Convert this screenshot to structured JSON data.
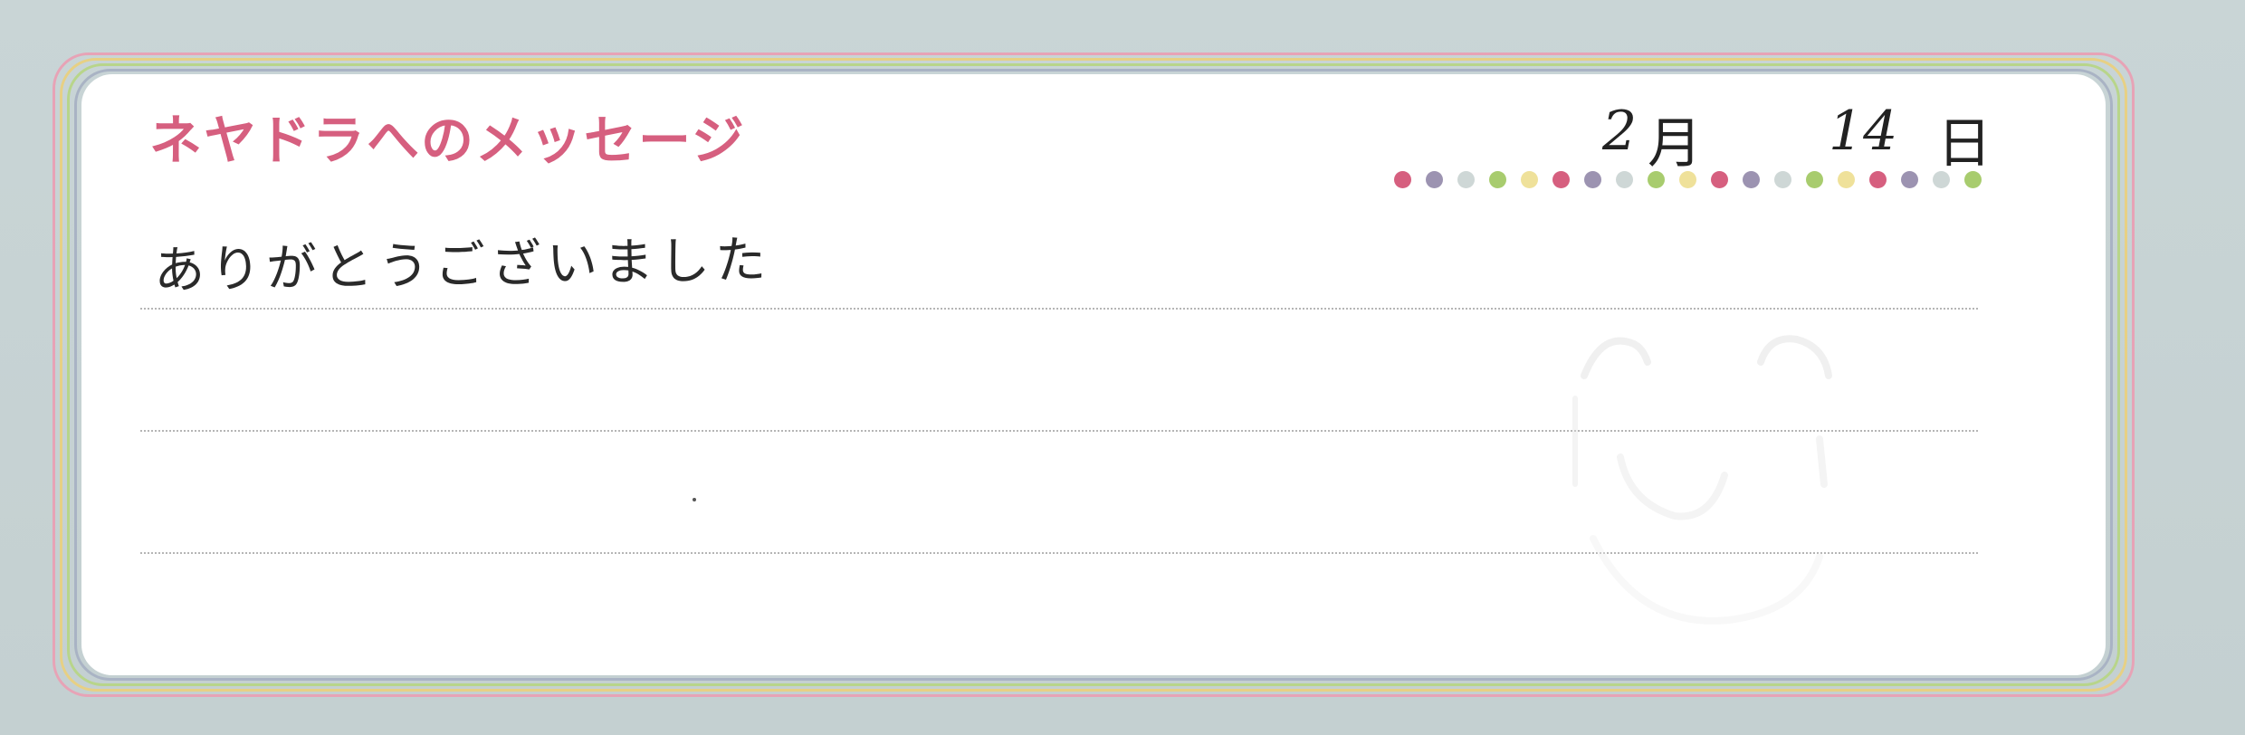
{
  "card": {
    "heading": "ネヤドラへのメッセージ",
    "date": {
      "month": "2",
      "month_label": "月",
      "day": "14",
      "day_label": "日"
    },
    "message": "ありがとうございました",
    "colors": {
      "heading": "#d65f7f",
      "background": "#c8d4d4",
      "border_pink": "#e7a3b6",
      "border_yellow": "#e7d084",
      "border_green": "#b8d58a",
      "border_gray": "#a9b3c4"
    },
    "dot_colors": [
      "#d65f7f",
      "#9c93b1",
      "#ced7d6",
      "#a8cc6e",
      "#efe19a",
      "#d65f7f",
      "#9c93b1",
      "#ced7d6",
      "#a8cc6e",
      "#efe19a",
      "#d65f7f",
      "#9c93b1",
      "#ced7d6",
      "#a8cc6e",
      "#efe19a",
      "#d65f7f",
      "#9c93b1",
      "#ced7d6",
      "#a8cc6e"
    ],
    "decoration_icon": "smiley-face-icon"
  }
}
